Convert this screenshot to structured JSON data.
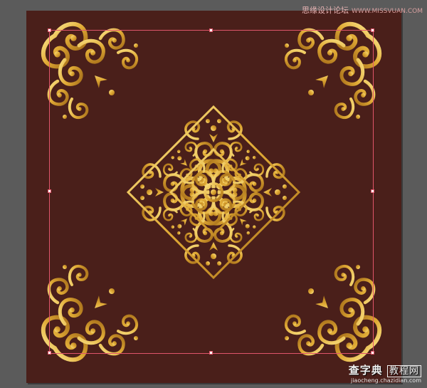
{
  "watermark_top": {
    "cn": "思缘设计论坛",
    "site": "WWW.MISSVUAN.COM"
  },
  "watermark_bottom": {
    "cn_main": "查字典",
    "cn_box": "教程网",
    "url": "jiaocheng.chazidian.com"
  },
  "colors": {
    "workspace": "#5b5b5b",
    "artboard": "#4a1f1a",
    "gold_light": "#f6d66a",
    "gold_mid": "#d9a531",
    "gold_dark": "#8a5a12",
    "selection": "#e0556a"
  },
  "icons": [
    "damask-center-ornament",
    "corner-ornament"
  ]
}
